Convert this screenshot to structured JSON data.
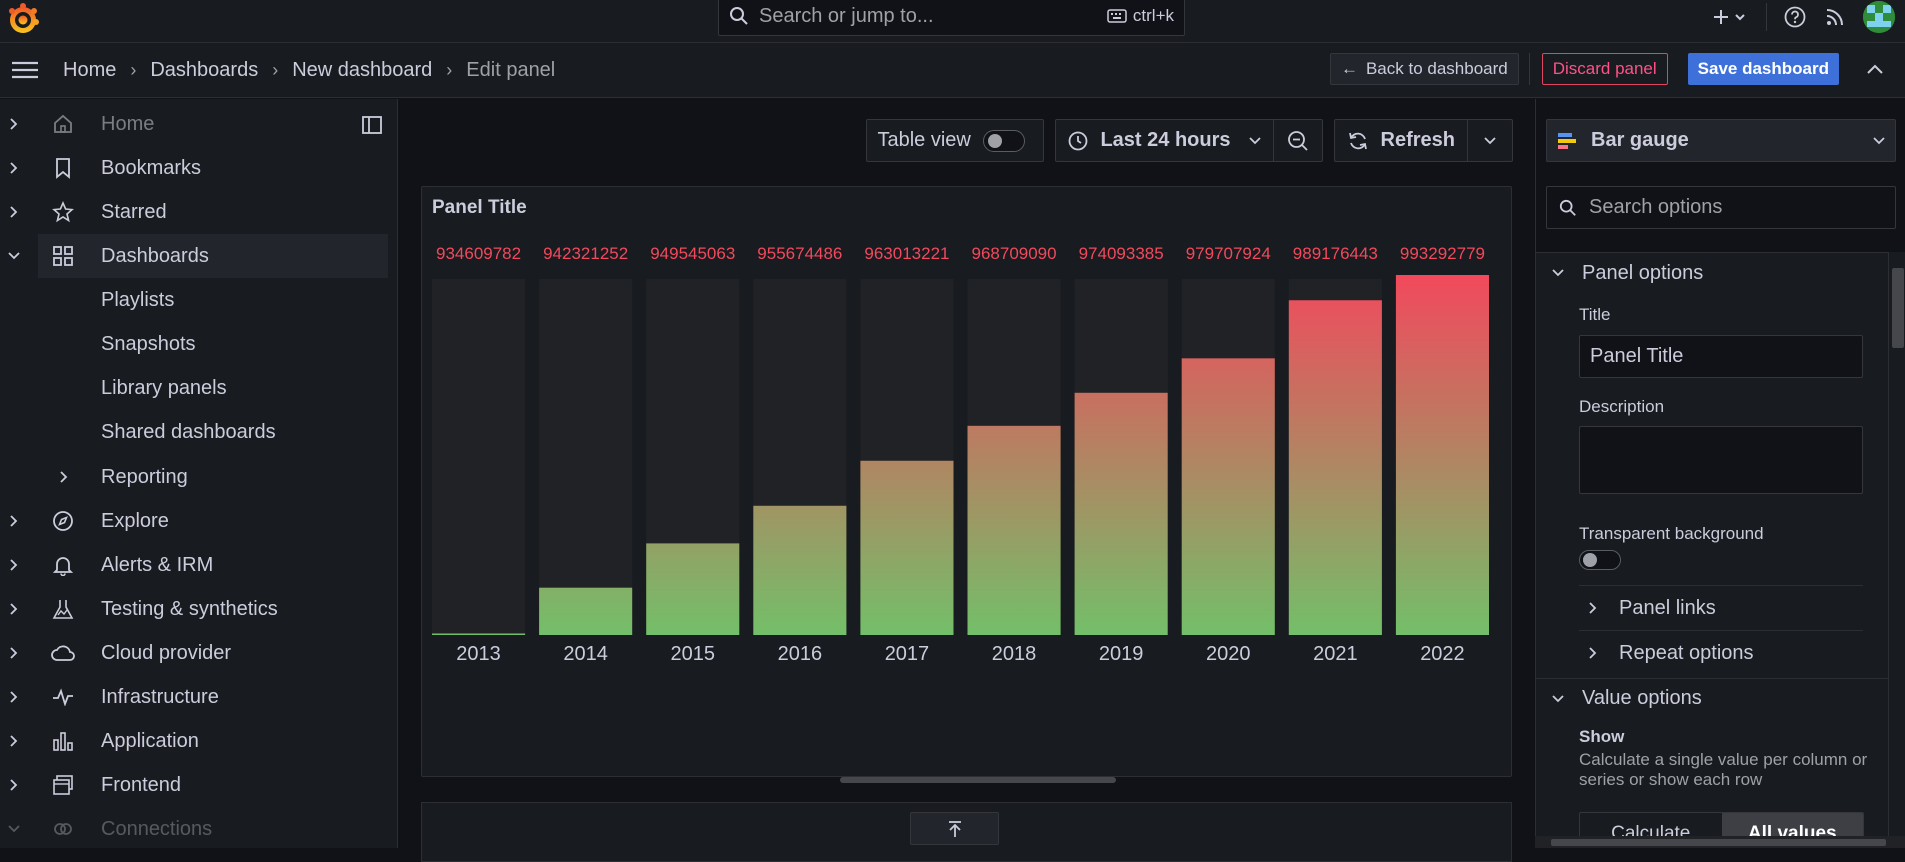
{
  "topbar": {
    "search_placeholder": "Search or jump to...",
    "shortcut": "ctrl+k"
  },
  "breadcrumb": [
    "Home",
    "Dashboards",
    "New dashboard",
    "Edit panel"
  ],
  "actions": {
    "back": "Back to dashboard",
    "discard": "Discard panel",
    "save": "Save dashboard"
  },
  "sidebar": {
    "items": [
      {
        "label": "Home",
        "icon": "home-icon"
      },
      {
        "label": "Bookmarks",
        "icon": "bookmark-icon"
      },
      {
        "label": "Starred",
        "icon": "star-icon"
      },
      {
        "label": "Dashboards",
        "icon": "apps-icon"
      },
      {
        "label": "Explore",
        "icon": "compass-icon"
      },
      {
        "label": "Alerts & IRM",
        "icon": "bell-icon"
      },
      {
        "label": "Testing & synthetics",
        "icon": "flask-icon"
      },
      {
        "label": "Cloud provider",
        "icon": "cloud-icon"
      },
      {
        "label": "Infrastructure",
        "icon": "heartbeat-icon"
      },
      {
        "label": "Application",
        "icon": "bar-chart-icon"
      },
      {
        "label": "Frontend",
        "icon": "frontend-icon"
      },
      {
        "label": "Connections",
        "icon": "link-icon"
      }
    ],
    "subitems": [
      "Playlists",
      "Snapshots",
      "Library panels",
      "Shared dashboards",
      "Reporting"
    ]
  },
  "toolbar": {
    "table_view": "Table view",
    "time_range": "Last 24 hours",
    "refresh": "Refresh"
  },
  "panel": {
    "title": "Panel Title"
  },
  "chart_data": {
    "type": "bar",
    "categories": [
      "2013",
      "2014",
      "2015",
      "2016",
      "2017",
      "2018",
      "2019",
      "2020",
      "2021",
      "2022"
    ],
    "values": [
      934609782,
      942321252,
      949545063,
      955674486,
      963013221,
      968709090,
      974093385,
      979707924,
      989176443,
      993292779
    ],
    "value_labels": [
      "934609782",
      "942321252",
      "949545063",
      "955674486",
      "963013221",
      "968709090",
      "974093385",
      "979707924",
      "989176443",
      "993292779"
    ],
    "ylim": [
      934609782,
      993292779
    ],
    "title": "Panel Title",
    "colors": {
      "low": "#73bf69",
      "high": "#f2495c",
      "track": "#202226",
      "value_text": "#f2495c"
    }
  },
  "options": {
    "viz": "Bar gauge",
    "search_placeholder": "Search options",
    "panel_options": "Panel options",
    "title_label": "Title",
    "title_value": "Panel Title",
    "description_label": "Description",
    "transparent_label": "Transparent background",
    "panel_links": "Panel links",
    "repeat_options": "Repeat options",
    "value_options": "Value options",
    "show_label": "Show",
    "show_desc": "Calculate a single value per column or series or show each row",
    "calculate": "Calculate",
    "all_values": "All values"
  }
}
